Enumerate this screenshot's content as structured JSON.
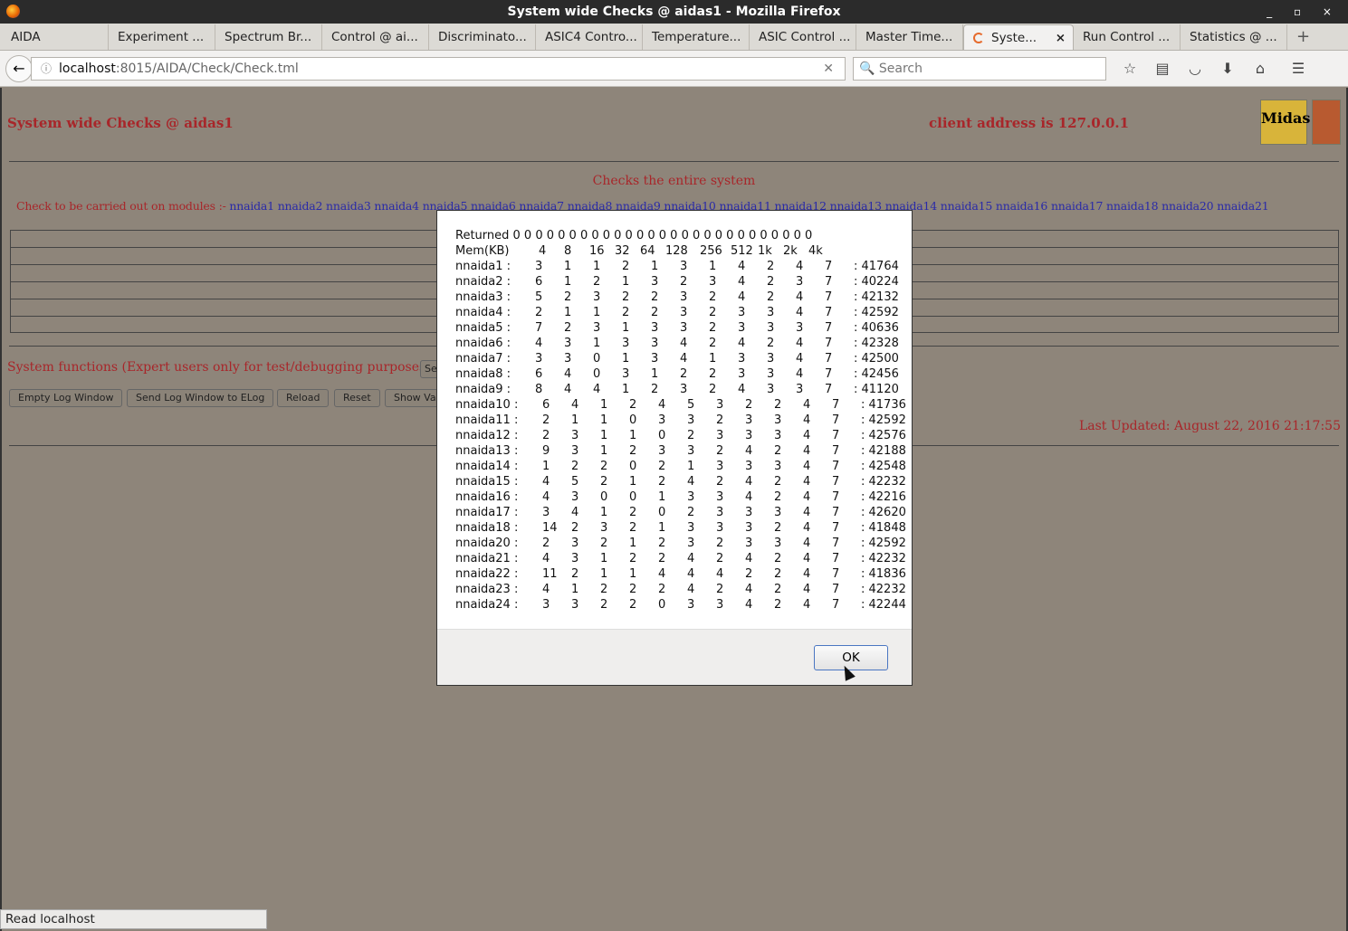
{
  "window": {
    "title": "System wide Checks @ aidas1 - Mozilla Firefox",
    "controls": "_ ▫ ×"
  },
  "tabs": [
    "AIDA",
    "Experiment ...",
    "Spectrum Br...",
    "Control @ ai...",
    "Discriminato...",
    "ASIC4 Contro...",
    "Temperature...",
    "ASIC Control ...",
    "Master Time...",
    "Syste...",
    "Run Control ...",
    "Statistics @ ..."
  ],
  "active_tab_index": 9,
  "nav": {
    "url_host": "localhost",
    "url_path": ":8015/AIDA/Check/Check.tml",
    "search_placeholder": "Search"
  },
  "page": {
    "title": "System wide Checks @ aidas1",
    "client": "client address is 127.0.0.1",
    "logo_text": "Midas",
    "subtitle": "Checks the entire system",
    "modules_label": "Check to be carried out on modules :- ",
    "modules": "nnaida1 nnaida2 nnaida3 nnaida4 nnaida5 nnaida6 nnaida7 nnaida8 nnaida9 nnaida10 nnaida11 nnaida12 nnaida13 nnaida14 nnaida15 nnaida16 nnaida17 nnaida18 nnaida20 nnaida21",
    "sysfunc": "System functions (Expert users only for test/debugging purposes!!!)",
    "sysfunc_btn": "Se",
    "buttons": [
      "Empty Log Window",
      "Send Log Window to ELog",
      "Reload",
      "Reset",
      "Show Var"
    ],
    "last_updated": "Last Updated: August 22, 2016 21:17:55"
  },
  "dialog": {
    "returned": "Returned 0 0 0 0 0 0 0 0 0 0 0 0 0 0 0 0 0 0 0 0 0 0 0 0 0 0 0",
    "mem_label": "Mem(KB)",
    "mem_cols": [
      "4",
      "8",
      "16",
      "32",
      "64",
      "128",
      "256",
      "512",
      "1k",
      "2k",
      "4k"
    ],
    "rows": [
      {
        "name": "nnaida1 :",
        "v": [
          3,
          1,
          1,
          2,
          1,
          3,
          1,
          4,
          2,
          4,
          7
        ],
        "t": ": 41764"
      },
      {
        "name": "nnaida2 :",
        "v": [
          6,
          1,
          2,
          1,
          3,
          2,
          3,
          4,
          2,
          3,
          7
        ],
        "t": ": 40224"
      },
      {
        "name": "nnaida3 :",
        "v": [
          5,
          2,
          3,
          2,
          2,
          3,
          2,
          4,
          2,
          4,
          7
        ],
        "t": ": 42132"
      },
      {
        "name": "nnaida4 :",
        "v": [
          2,
          1,
          1,
          2,
          2,
          3,
          2,
          3,
          3,
          4,
          7
        ],
        "t": ": 42592"
      },
      {
        "name": "nnaida5 :",
        "v": [
          7,
          2,
          3,
          1,
          3,
          3,
          2,
          3,
          3,
          3,
          7
        ],
        "t": ": 40636"
      },
      {
        "name": "nnaida6 :",
        "v": [
          4,
          3,
          1,
          3,
          3,
          4,
          2,
          4,
          2,
          4,
          7
        ],
        "t": ": 42328"
      },
      {
        "name": "nnaida7 :",
        "v": [
          3,
          3,
          0,
          1,
          3,
          4,
          1,
          3,
          3,
          4,
          7
        ],
        "t": ": 42500"
      },
      {
        "name": "nnaida8 :",
        "v": [
          6,
          4,
          0,
          3,
          1,
          2,
          2,
          3,
          3,
          4,
          7
        ],
        "t": ": 42456"
      },
      {
        "name": "nnaida9 :",
        "v": [
          8,
          4,
          4,
          1,
          2,
          3,
          2,
          4,
          3,
          3,
          7
        ],
        "t": ": 41120"
      },
      {
        "name": "nnaida10 :",
        "v": [
          6,
          4,
          1,
          2,
          4,
          5,
          3,
          2,
          2,
          4,
          7
        ],
        "t": ": 41736"
      },
      {
        "name": "nnaida11 :",
        "v": [
          2,
          1,
          1,
          0,
          3,
          3,
          2,
          3,
          3,
          4,
          7
        ],
        "t": ": 42592"
      },
      {
        "name": "nnaida12 :",
        "v": [
          2,
          3,
          1,
          1,
          0,
          2,
          3,
          3,
          3,
          4,
          7
        ],
        "t": ": 42576"
      },
      {
        "name": "nnaida13 :",
        "v": [
          9,
          3,
          1,
          2,
          3,
          3,
          2,
          4,
          2,
          4,
          7
        ],
        "t": ": 42188"
      },
      {
        "name": "nnaida14 :",
        "v": [
          1,
          2,
          2,
          0,
          2,
          1,
          3,
          3,
          3,
          4,
          7
        ],
        "t": ": 42548"
      },
      {
        "name": "nnaida15 :",
        "v": [
          4,
          5,
          2,
          1,
          2,
          4,
          2,
          4,
          2,
          4,
          7
        ],
        "t": ": 42232"
      },
      {
        "name": "nnaida16 :",
        "v": [
          4,
          3,
          0,
          0,
          1,
          3,
          3,
          4,
          2,
          4,
          7
        ],
        "t": ": 42216"
      },
      {
        "name": "nnaida17 :",
        "v": [
          3,
          4,
          1,
          2,
          0,
          2,
          3,
          3,
          3,
          4,
          7
        ],
        "t": ": 42620"
      },
      {
        "name": "nnaida18 :",
        "v": [
          14,
          2,
          3,
          2,
          1,
          3,
          3,
          3,
          2,
          4,
          7
        ],
        "t": ": 41848"
      },
      {
        "name": "nnaida20 :",
        "v": [
          2,
          3,
          2,
          1,
          2,
          3,
          2,
          3,
          3,
          4,
          7
        ],
        "t": ": 42592"
      },
      {
        "name": "nnaida21 :",
        "v": [
          4,
          3,
          1,
          2,
          2,
          4,
          2,
          4,
          2,
          4,
          7
        ],
        "t": ": 42232"
      },
      {
        "name": "nnaida22 :",
        "v": [
          11,
          2,
          1,
          1,
          4,
          4,
          4,
          2,
          2,
          4,
          7
        ],
        "t": ": 41836"
      },
      {
        "name": "nnaida23 :",
        "v": [
          4,
          1,
          2,
          2,
          2,
          4,
          2,
          4,
          2,
          4,
          7
        ],
        "t": ": 42232"
      },
      {
        "name": "nnaida24 :",
        "v": [
          3,
          3,
          2,
          2,
          0,
          3,
          3,
          4,
          2,
          4,
          7
        ],
        "t": ": 42244"
      }
    ],
    "ok": "OK"
  },
  "status": "Read localhost"
}
